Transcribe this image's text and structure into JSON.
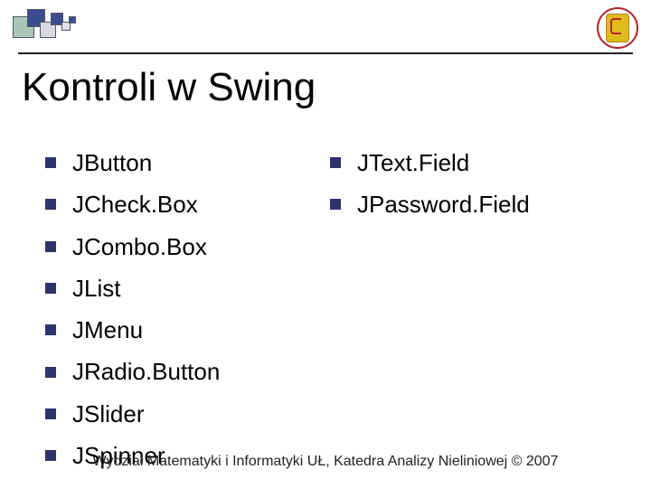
{
  "title": "Kontroli w Swing",
  "column_left": [
    "JButton",
    "JCheck.Box",
    "JCombo.Box",
    "JList",
    "JMenu",
    "JRadio.Button",
    "JSlider",
    "JSpinner"
  ],
  "column_right": [
    "JText.Field",
    "JPassword.Field"
  ],
  "footer": "Wydział Matematyki i Informatyki UŁ, Katedra Analizy Nieliniowej © 2007"
}
